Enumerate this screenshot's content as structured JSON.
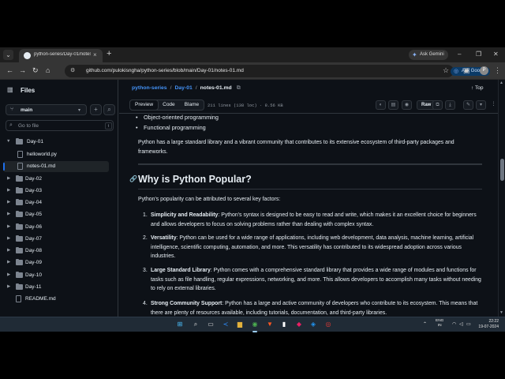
{
  "browser": {
    "tab_title": "python-series/Day-01/notes-01.m",
    "new_tab_symbol": "+",
    "ask_gemini": "Ask Gemini",
    "url": "github.com/pulokisngha/python-series/blob/main/Day-01/notes-01.md",
    "ask_google": "Ask Google",
    "profile_initial": "P"
  },
  "sidebar": {
    "title": "Files",
    "branch": "main",
    "filter_placeholder": "Go to file",
    "filter_kbd": "t",
    "items": [
      {
        "label": "Day-01",
        "type": "folder",
        "open": true
      },
      {
        "label": "helloworld.py",
        "type": "file"
      },
      {
        "label": "notes-01.md",
        "type": "file",
        "active": true
      },
      {
        "label": "Day-02",
        "type": "folder"
      },
      {
        "label": "Day-03",
        "type": "folder"
      },
      {
        "label": "Day-04",
        "type": "folder"
      },
      {
        "label": "Day-05",
        "type": "folder"
      },
      {
        "label": "Day-06",
        "type": "folder"
      },
      {
        "label": "Day-07",
        "type": "folder"
      },
      {
        "label": "Day-08",
        "type": "folder"
      },
      {
        "label": "Day-09",
        "type": "folder"
      },
      {
        "label": "Day-10",
        "type": "folder"
      },
      {
        "label": "Day-11",
        "type": "folder"
      },
      {
        "label": "README.md",
        "type": "file"
      }
    ]
  },
  "header": {
    "repo": "python-series",
    "folder": "Day-01",
    "file": "notes-01.md",
    "top_label": "Top",
    "tabs": [
      "Preview",
      "Code",
      "Blame"
    ],
    "line_info": "211 lines (138 loc) · 8.56 KB",
    "raw_label": "Raw"
  },
  "content": {
    "bullets": [
      "Object-oriented programming",
      "Functional programming"
    ],
    "para1": "Python has a large standard library and a vibrant community that contributes to its extensive ecosystem of third-party packages and frameworks.",
    "h2": "Why is Python Popular?",
    "para2": "Python's popularity can be attributed to several key factors:",
    "list": [
      {
        "n": "1.",
        "title": "Simplicity and Readability",
        "text": ": Python's syntax is designed to be easy to read and write, which makes it an excellent choice for beginners and allows developers to focus on solving problems rather than dealing with complex syntax."
      },
      {
        "n": "2.",
        "title": "Versatility",
        "text": ": Python can be used for a wide range of applications, including web development, data analysis, machine learning, artificial intelligence, scientific computing, automation, and more. This versatility has contributed to its widespread adoption across various industries."
      },
      {
        "n": "3.",
        "title": "Large Standard Library",
        "text": ": Python comes with a comprehensive standard library that provides a wide range of modules and functions for tasks such as file handling, regular expressions, networking, and more. This allows developers to accomplish many tasks without needing to rely on external libraries."
      },
      {
        "n": "4.",
        "title": "Strong Community Support",
        "text": ": Python has a large and active community of developers who contribute to its ecosystem. This means that there are plenty of resources available, including tutorials, documentation, and third-party libraries."
      }
    ]
  },
  "taskbar": {
    "lang": "ENG\nIN",
    "time": "22:22",
    "date": "19-07-2024"
  }
}
